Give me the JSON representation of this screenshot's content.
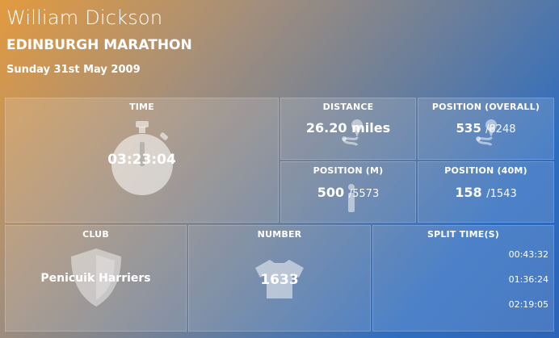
{
  "runner": {
    "name": "William Dickson",
    "event": "EDINBURGH MARATHON",
    "date": "Sunday 31st May 2009"
  },
  "tiles": {
    "time": {
      "label": "TIME",
      "value": "03:23:04",
      "icon": "stopwatch-icon"
    },
    "distance": {
      "label": "DISTANCE",
      "value": "26.20 miles",
      "icon": "route-icon"
    },
    "position_overall": {
      "label": "POSITION (OVERALL)",
      "value": "535",
      "total": "/8248",
      "icon": "route-icon"
    },
    "position_m": {
      "label": "POSITION (M)",
      "value": "500",
      "total": "/5573",
      "icon": "person-icon"
    },
    "position_40m": {
      "label": "POSITION (40M)",
      "value": "158",
      "total": "/1543"
    },
    "club": {
      "label": "CLUB",
      "value": "Penicuik Harriers",
      "icon": "shield-icon"
    },
    "number": {
      "label": "NUMBER",
      "value": "1633",
      "icon": "tshirt-icon"
    },
    "split_times": {
      "label": "SPLIT TIME(S)",
      "values": [
        "00:43:32",
        "01:36:24",
        "02:19:05"
      ]
    }
  }
}
